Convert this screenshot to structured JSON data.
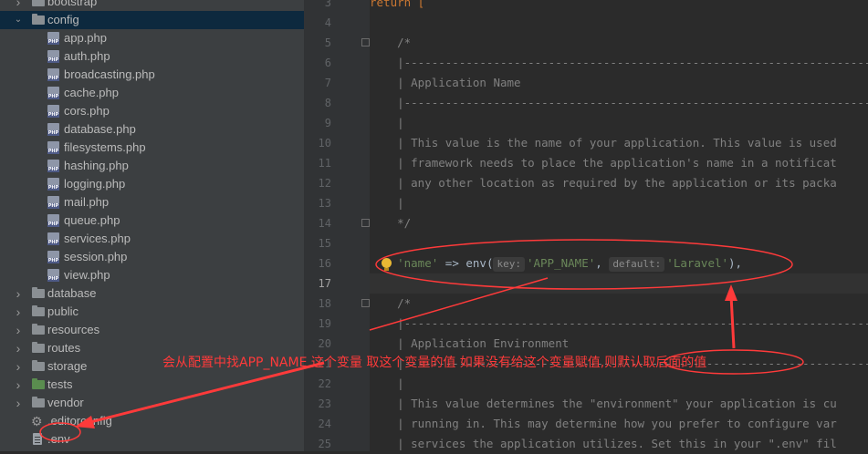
{
  "project_tree": {
    "items": [
      {
        "type": "folder",
        "label": "bootstrap",
        "expanded": false,
        "depth": 0
      },
      {
        "type": "folder",
        "label": "config",
        "expanded": true,
        "depth": 0
      },
      {
        "type": "php",
        "label": "app.php",
        "depth": 1
      },
      {
        "type": "php",
        "label": "auth.php",
        "depth": 1
      },
      {
        "type": "php",
        "label": "broadcasting.php",
        "depth": 1
      },
      {
        "type": "php",
        "label": "cache.php",
        "depth": 1
      },
      {
        "type": "php",
        "label": "cors.php",
        "depth": 1
      },
      {
        "type": "php",
        "label": "database.php",
        "depth": 1
      },
      {
        "type": "php",
        "label": "filesystems.php",
        "depth": 1
      },
      {
        "type": "php",
        "label": "hashing.php",
        "depth": 1
      },
      {
        "type": "php",
        "label": "logging.php",
        "depth": 1
      },
      {
        "type": "php",
        "label": "mail.php",
        "depth": 1
      },
      {
        "type": "php",
        "label": "queue.php",
        "depth": 1
      },
      {
        "type": "php",
        "label": "services.php",
        "depth": 1
      },
      {
        "type": "php",
        "label": "session.php",
        "depth": 1
      },
      {
        "type": "php",
        "label": "view.php",
        "depth": 1
      },
      {
        "type": "folder",
        "label": "database",
        "expanded": false,
        "depth": 0
      },
      {
        "type": "folder",
        "label": "public",
        "expanded": false,
        "depth": 0
      },
      {
        "type": "folder",
        "label": "resources",
        "expanded": false,
        "depth": 0
      },
      {
        "type": "folder",
        "label": "routes",
        "expanded": false,
        "depth": 0
      },
      {
        "type": "folder",
        "label": "storage",
        "expanded": false,
        "depth": 0
      },
      {
        "type": "folder-green",
        "label": "tests",
        "expanded": false,
        "depth": 0
      },
      {
        "type": "folder",
        "label": "vendor",
        "expanded": false,
        "depth": 0
      },
      {
        "type": "config",
        "label": ".editorconfig",
        "depth": 0
      },
      {
        "type": "env",
        "label": ".env",
        "depth": 0
      }
    ],
    "selected_index": 1
  },
  "editor": {
    "lines": [
      {
        "n": "3",
        "text": "return ["
      },
      {
        "n": "4",
        "text": ""
      },
      {
        "n": "5",
        "text": "    /*"
      },
      {
        "n": "6",
        "text": "    |--------------------------------------------------------------------------"
      },
      {
        "n": "7",
        "text": "    | Application Name"
      },
      {
        "n": "8",
        "text": "    |--------------------------------------------------------------------------"
      },
      {
        "n": "9",
        "text": "    |"
      },
      {
        "n": "10",
        "text": "    | This value is the name of your application. This value is used"
      },
      {
        "n": "11",
        "text": "    | framework needs to place the application's name in a notificat"
      },
      {
        "n": "12",
        "text": "    | any other location as required by the application or its packa"
      },
      {
        "n": "13",
        "text": "    |"
      },
      {
        "n": "14",
        "text": "    */"
      },
      {
        "n": "15",
        "text": ""
      },
      {
        "n": "16",
        "text": ""
      },
      {
        "n": "17",
        "text": ""
      },
      {
        "n": "18",
        "text": "    /*"
      },
      {
        "n": "19",
        "text": "    |--------------------------------------------------------------------------"
      },
      {
        "n": "20",
        "text": "    | Application Environment"
      },
      {
        "n": "21",
        "text": "    |--------------------------------------------------------------------------"
      },
      {
        "n": "22",
        "text": "    |"
      },
      {
        "n": "23",
        "text": "    | This value determines the \"environment\" your application is cu"
      },
      {
        "n": "24",
        "text": "    | running in. This may determine how you prefer to configure var"
      },
      {
        "n": "25",
        "text": "    | services the application utilizes. Set this in your \".env\" fil"
      }
    ],
    "current_line": "17",
    "line16": {
      "key": "'name'",
      "arrow": " => ",
      "call": "env(",
      "hint_key": "key:",
      "arg1": "'APP_NAME'",
      "comma": ", ",
      "hint_default": "default:",
      "arg2": "'Laravel'",
      "end": "),"
    }
  },
  "annotation": {
    "text": "会从配置中找APP_NAME 这个变量 取这个变量的值 如果没有给这个变量赋值,则默认取后面的值",
    "color": "#ff3a3a"
  }
}
